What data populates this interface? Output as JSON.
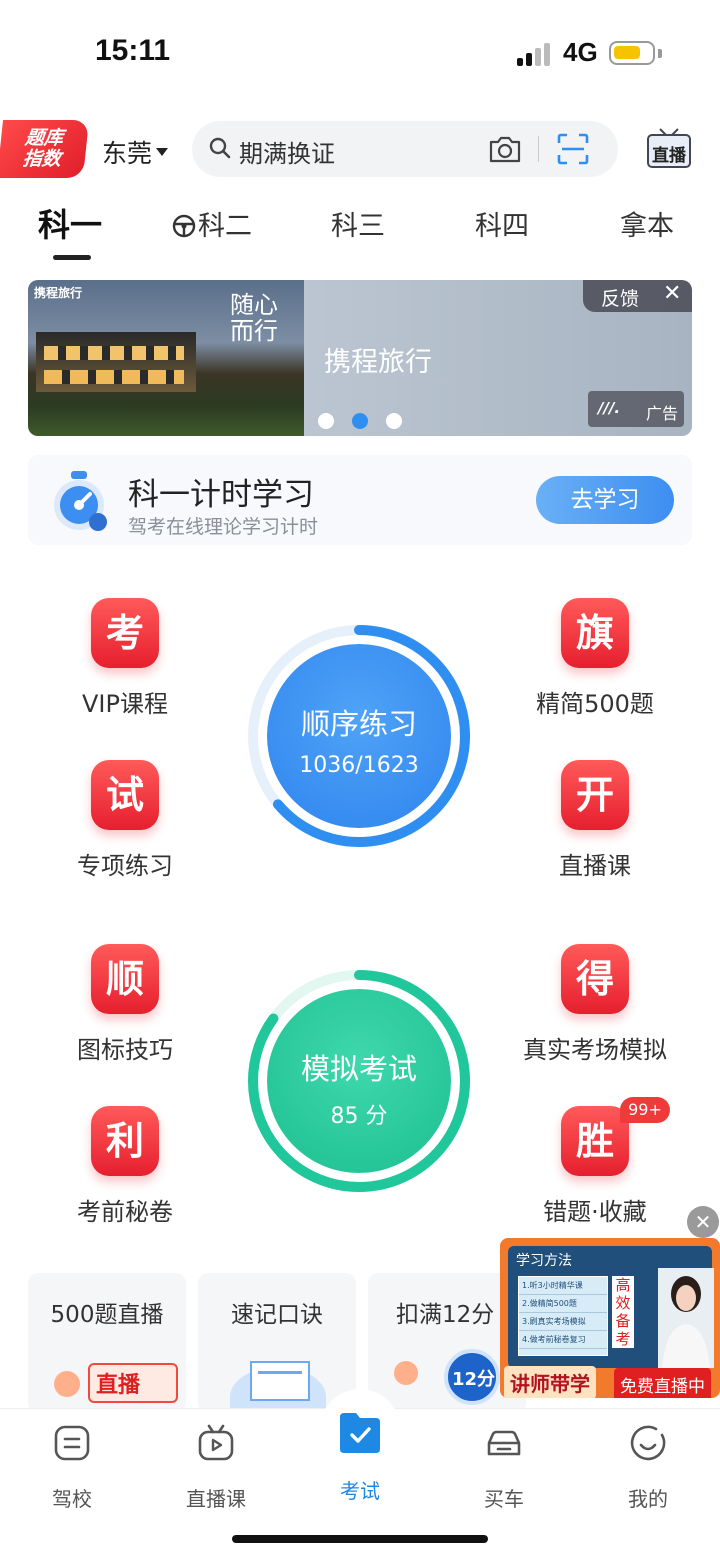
{
  "status_bar": {
    "time": "15:11",
    "network": "4G"
  },
  "header": {
    "badge_line1": "题库",
    "badge_line2": "指数",
    "city": "东莞",
    "search_text": "期满换证",
    "live_label": "直播"
  },
  "tabs": [
    {
      "label": "科一"
    },
    {
      "label": "科二"
    },
    {
      "label": "科三"
    },
    {
      "label": "科四"
    },
    {
      "label": "拿本"
    }
  ],
  "banner": {
    "brand": "携程旅行",
    "slogan": "随心而行",
    "title": "携程旅行",
    "feedback_label": "反馈",
    "ad_label": "广告",
    "dots": 3,
    "active_dot": 1
  },
  "timer_card": {
    "title": "科一计时学习",
    "subtitle": "驾考在线理论学习计时",
    "button_label": "去学习"
  },
  "features": {
    "vip": {
      "glyph": "考",
      "label": "VIP课程"
    },
    "jingjian": {
      "glyph": "旗",
      "label": "精简500题"
    },
    "zhuanxiang": {
      "glyph": "试",
      "label": "专项练习"
    },
    "zhibo": {
      "glyph": "开",
      "label": "直播课"
    },
    "tubiao": {
      "glyph": "顺",
      "label": "图标技巧"
    },
    "zhenshi": {
      "glyph": "得",
      "label": "真实考场模拟"
    },
    "kaoqian": {
      "glyph": "利",
      "label": "考前秘卷"
    },
    "cuoti": {
      "glyph": "胜",
      "label": "错题·收藏",
      "badge": "99+"
    }
  },
  "sequential_practice": {
    "title": "顺序练习",
    "progress_text": "1036/1623",
    "done": 1036,
    "total": 1623
  },
  "mock_exam": {
    "title": "模拟考试",
    "score_text": "85 分",
    "score": 85,
    "max": 100
  },
  "mini_cards": [
    {
      "title": "500题直播",
      "art_text": "直播"
    },
    {
      "title": "速记口诀"
    },
    {
      "title": "扣满12分",
      "art_text": "12分"
    }
  ],
  "promo": {
    "header": "学习方法",
    "list": [
      "1.听3小时精华课",
      "2.做精简500题",
      "3.刷真实考场模拟",
      "4.做考前秘卷复习"
    ],
    "side_text": "高效备考",
    "left_label": "讲师带学",
    "right_label": "免费直播中"
  },
  "bottom_nav": [
    {
      "label": "驾校"
    },
    {
      "label": "直播课"
    },
    {
      "label": "考试"
    },
    {
      "label": "买车"
    },
    {
      "label": "我的"
    }
  ],
  "colors": {
    "accent": "#1e88e5",
    "red": "#e61f2e",
    "blue_circle": "#2f8ff0",
    "green_circle": "#1fc79a"
  }
}
